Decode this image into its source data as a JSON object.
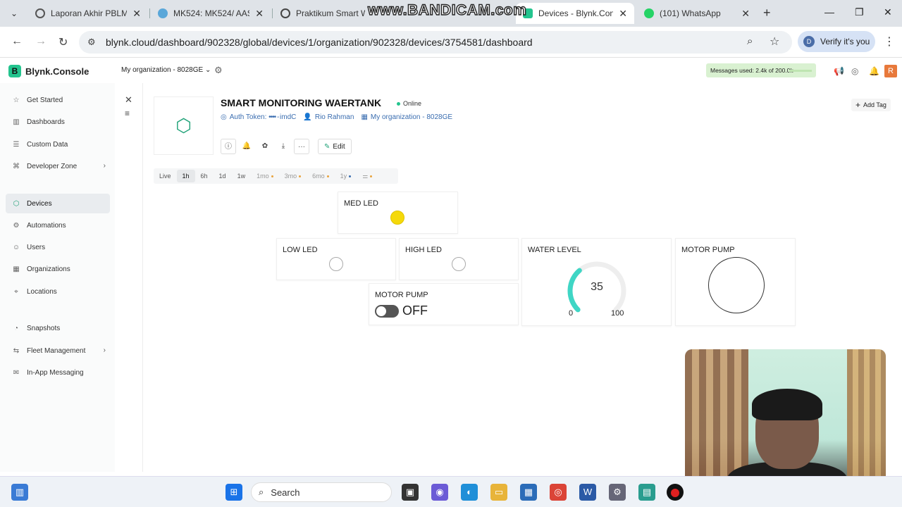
{
  "browser": {
    "tabs": [
      {
        "title": "Laporan Akhir PBLMK",
        "icon_color": "#2b5aa6",
        "active": false
      },
      {
        "title": "MK524: MK524/ AAS",
        "icon_color": "#5aa7d9",
        "active": false
      },
      {
        "title": "Praktikum Smart Wat",
        "icon_color": "#444444",
        "active": false
      },
      {
        "title": "Devices - Blynk.Conso",
        "icon_color": "#23c48e",
        "active": true
      },
      {
        "title": "(101) WhatsApp",
        "icon_color": "#25d366",
        "active": false
      }
    ],
    "watermark": "www.BANDICAM.com",
    "url": "blynk.cloud/dashboard/902328/global/devices/1/organization/902328/devices/3754581/dashboard",
    "verify_label": "Verify it's you",
    "verify_initial": "D"
  },
  "app": {
    "logo_letter": "B",
    "logo_text": "Blynk.Console",
    "org_selector": "My organization - 8028GE",
    "messages_used": "Messages used: 2.4k of 200.0k",
    "avatar_letter": "R"
  },
  "sidebar": {
    "items": [
      {
        "label": "Get Started",
        "icon": "star-icon",
        "glyph": "☆"
      },
      {
        "label": "Dashboards",
        "icon": "chart-icon",
        "glyph": "▥"
      },
      {
        "label": "Custom Data",
        "icon": "database-icon",
        "glyph": "☰"
      },
      {
        "label": "Developer Zone",
        "icon": "code-icon",
        "glyph": "⌘"
      },
      {
        "label": "Devices",
        "icon": "cube-icon",
        "glyph": "⬡"
      },
      {
        "label": "Automations",
        "icon": "automation-icon",
        "glyph": "⚙"
      },
      {
        "label": "Users",
        "icon": "users-icon",
        "glyph": "☺"
      },
      {
        "label": "Organizations",
        "icon": "org-icon",
        "glyph": "▦"
      },
      {
        "label": "Locations",
        "icon": "location-icon",
        "glyph": "⌖"
      },
      {
        "label": "Snapshots",
        "icon": "snapshot-icon",
        "glyph": "◔"
      },
      {
        "label": "Fleet Management",
        "icon": "fleet-icon",
        "glyph": "⇆"
      },
      {
        "label": "In-App Messaging",
        "icon": "message-icon",
        "glyph": "✉"
      }
    ]
  },
  "device": {
    "title": "SMART MONITORING WAERTANK",
    "status": "Online",
    "auth_token_label": "Auth Token:",
    "auth_token_value": "imdC",
    "owner": "Rio Rahman",
    "organization": "My organization - 8028GE",
    "edit_label": "Edit",
    "add_tag_label": "Add Tag"
  },
  "time_ranges": [
    {
      "label": "Live",
      "state": "normal"
    },
    {
      "label": "1h",
      "state": "active"
    },
    {
      "label": "6h",
      "state": "normal"
    },
    {
      "label": "1d",
      "state": "normal"
    },
    {
      "label": "1w",
      "state": "normal"
    },
    {
      "label": "1mo",
      "state": "dim"
    },
    {
      "label": "3mo",
      "state": "dim"
    },
    {
      "label": "6mo",
      "state": "dim"
    },
    {
      "label": "1y",
      "state": "dim"
    }
  ],
  "widgets": {
    "med_led": {
      "title": "MED LED",
      "on": true,
      "color": "#f5d90a"
    },
    "low_led": {
      "title": "LOW LED",
      "on": false
    },
    "high_led": {
      "title": "HIGH LED",
      "on": false
    },
    "motor_switch": {
      "title": "MOTOR PUMP",
      "state_label": "OFF"
    },
    "water_level": {
      "title": "WATER LEVEL",
      "value": 35,
      "min": 0,
      "max": 100,
      "accent": "#3fd6c5"
    },
    "motor_indicator": {
      "title": "MOTOR PUMP"
    }
  },
  "taskbar": {
    "search_label": "Search"
  }
}
